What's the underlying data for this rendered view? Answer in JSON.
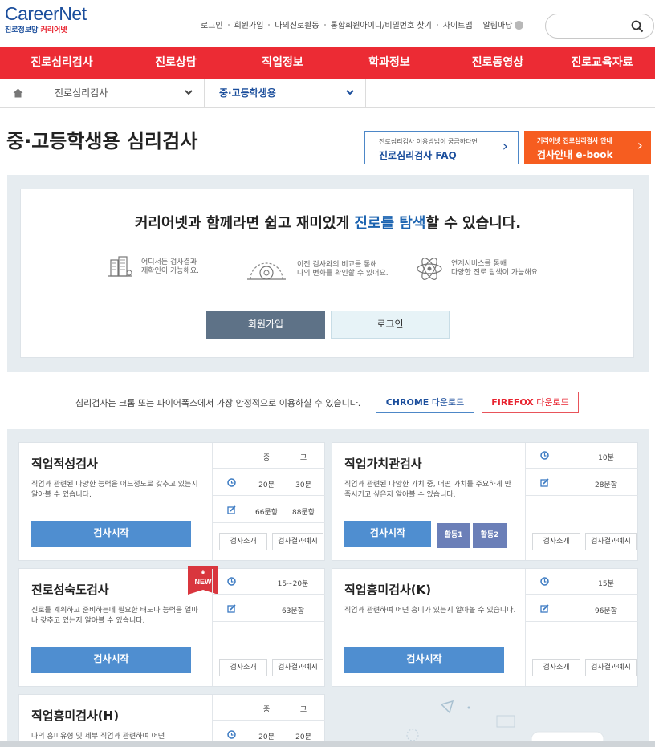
{
  "header": {
    "logo_main": "CareerNet",
    "logo_sub_a": "진로정보망 ",
    "logo_sub_b": "커리어넷",
    "top_links": [
      "로그인",
      "회원가입",
      "나의진로활동",
      "통합회원아이디/비밀번호 찾기",
      "사이트맵",
      "알림마당"
    ],
    "search_placeholder": ""
  },
  "gnb": [
    "진로심리검사",
    "진로상담",
    "직업정보",
    "학과정보",
    "진로동영상",
    "진로교육자료"
  ],
  "breadcrumb": {
    "level1": "진로심리검사",
    "level2": "중·고등학생용"
  },
  "page_title": "중·고등학생용 심리검사",
  "faq": {
    "small": "진로심리검사 이용방법이 궁금하다면",
    "main": "진로심리검사 FAQ"
  },
  "ebook": {
    "small": "커리어넷 진로심리검사 안내",
    "main": "검사안내 e-book"
  },
  "intro": {
    "head_a": "커리어넷과 함께라면 쉽고 재미있게 ",
    "head_hl": "진로를 탐색",
    "head_b": "할 수 있습니다.",
    "features": [
      {
        "icon": "building-icon",
        "line1": "어디서든 검사결과",
        "line2": "재확인이 가능해요."
      },
      {
        "icon": "gear-icon",
        "line1": "이전 검사와의 비교를 통해",
        "line2": "나의 변화를 확인할 수 있어요."
      },
      {
        "icon": "atom-icon",
        "line1": "연계서비스를 통해",
        "line2": "다양한 진로 탐색이 가능해요."
      }
    ],
    "join": "회원가입",
    "login": "로그인"
  },
  "browser_note": {
    "text": "심리검사는 크롬 또는 파이어폭스에서 가장 안정적으로 이용하실 수 있습니다.",
    "chrome_b": "CHROME",
    "chrome_t": " 다운로드",
    "ff_b": "FIREFOX",
    "ff_t": " 다운로드"
  },
  "labels": {
    "middle": "중",
    "high": "고",
    "intro": "검사소개",
    "example": "검사결과예시",
    "start": "검사시작",
    "new": "NEW"
  },
  "tests": [
    {
      "name": "직업적성검사",
      "desc": "직업과 관련된 다양한 능력을 어느정도로 갖추고 있는지 알아볼 수 있습니다.",
      "time_m": "20분",
      "time_h": "30분",
      "q_m": "66문항",
      "q_h": "88문항"
    },
    {
      "name": "직업가치관검사",
      "desc": "직업과 관련된 다양한 가치 중, 어떤 가치를 주요하게 만족시키고 싶은지 알아볼 수 있습니다.",
      "time": "10분",
      "q": "28문항",
      "act1": "활동1",
      "act2": "활동2"
    },
    {
      "name": "진로성숙도검사",
      "desc": "진로를 계획하고 준비하는데 필요한 태도나 능력을 얼마나 갖추고 있는지 알아볼 수 있습니다.",
      "time": "15~20분",
      "q": "63문항"
    },
    {
      "name": "직업흥미검사(K)",
      "desc": "직업과 관련하여 어떤 흥미가 있는지 알아볼 수 있습니다.",
      "time": "15분",
      "q": "96문항"
    },
    {
      "name": "직업흥미검사(H)",
      "desc": "나의 흥미유형 및 세부 직업과 관련하여 어떤",
      "time_m": "20분",
      "time_h": "20분"
    }
  ]
}
